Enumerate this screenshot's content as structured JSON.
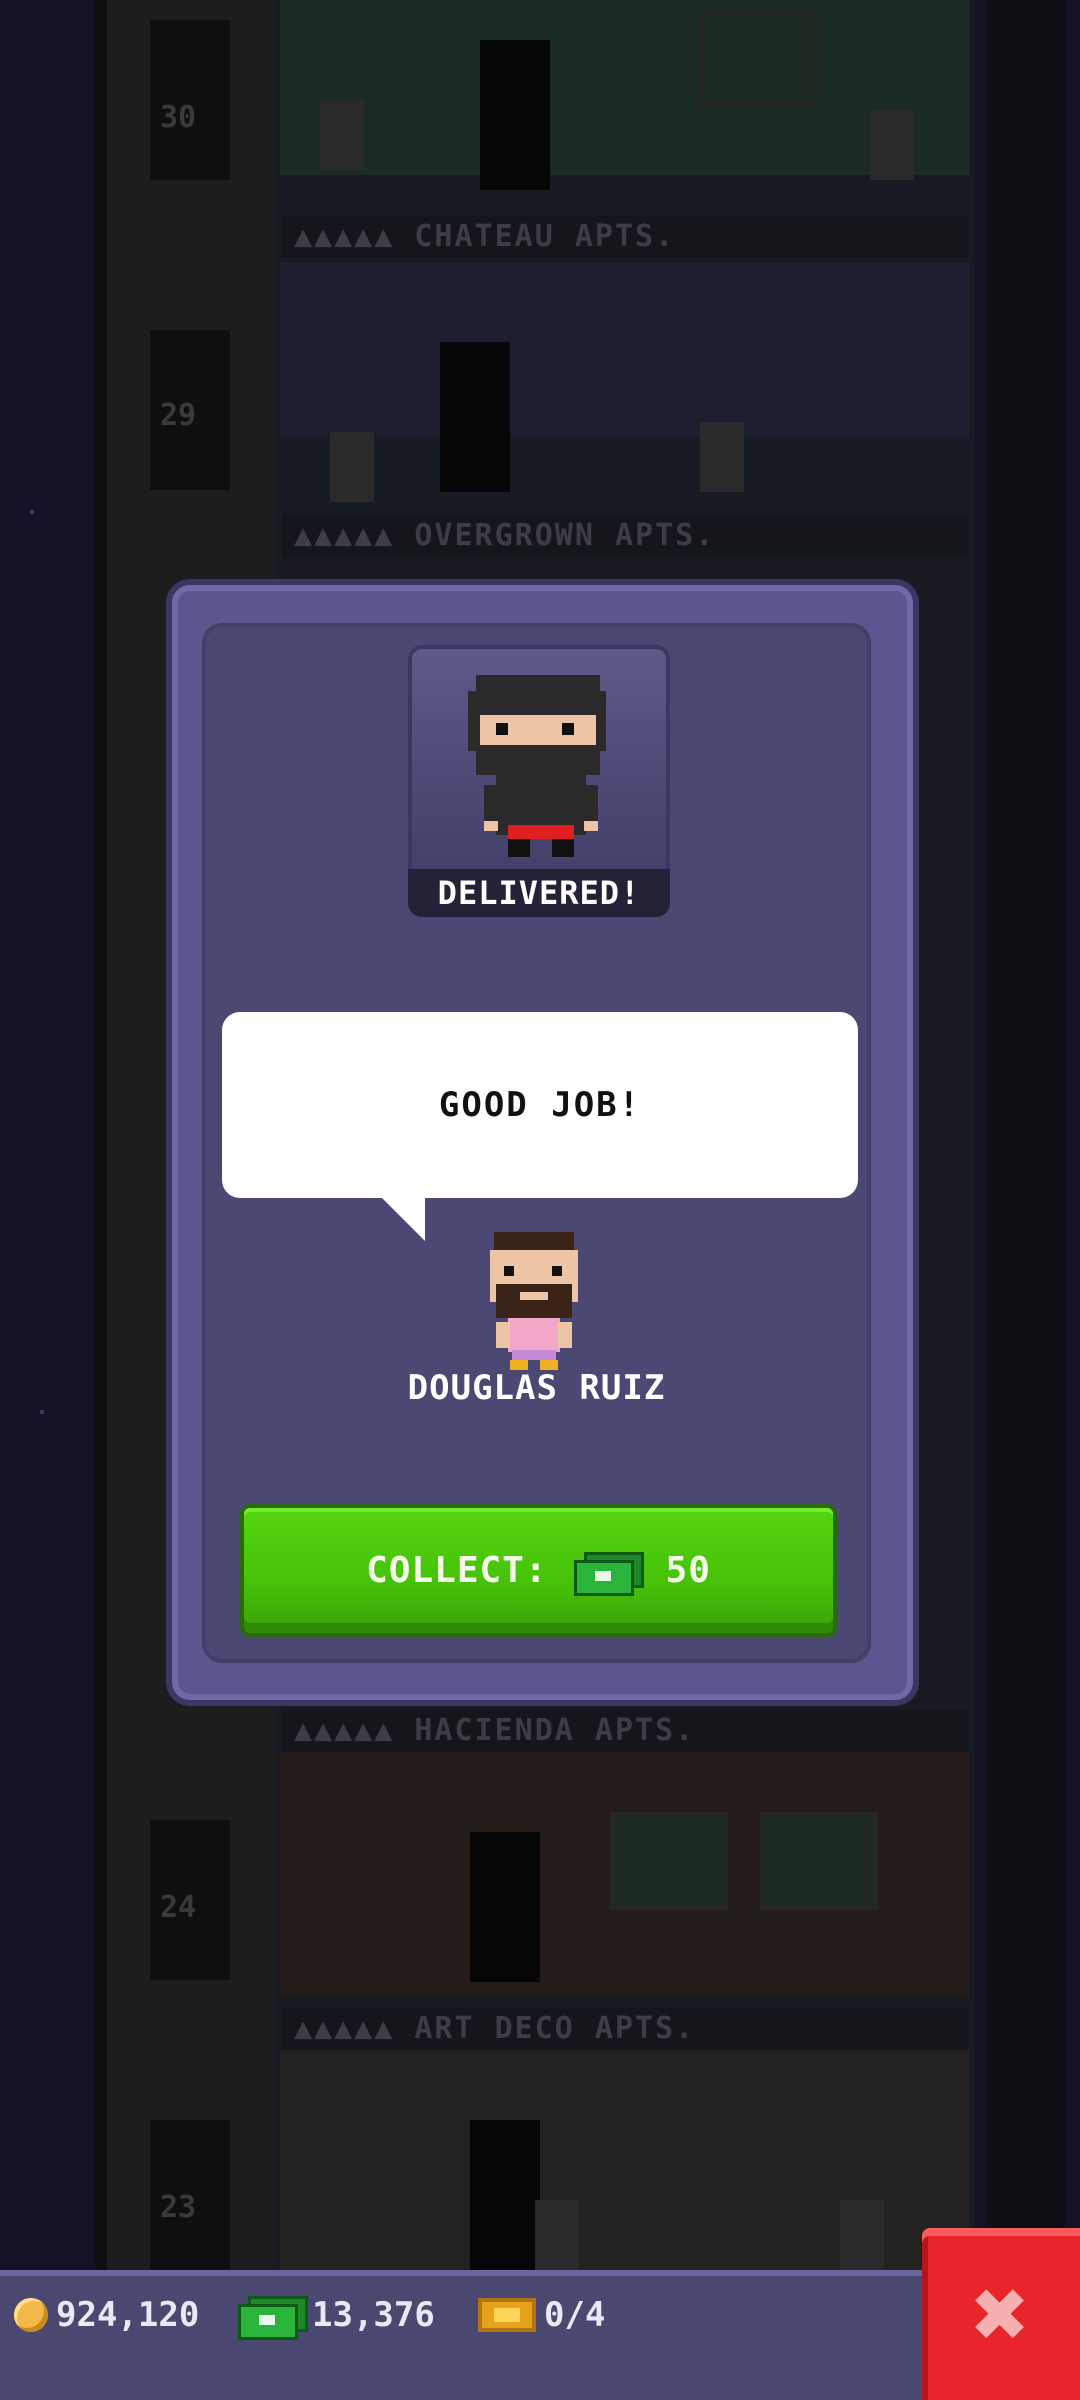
{
  "tower": {
    "floors": [
      {
        "number": "30",
        "banner": "▲▲▲▲▲ CHATEAU APTS."
      },
      {
        "number": "29",
        "banner": "▲▲▲▲▲ OVERGROWN APTS."
      },
      {
        "number": "24",
        "banner": "▲▲▲▲▲ HACIENDA APTS."
      },
      {
        "number": "23",
        "banner": "▲▲▲▲▲ ART DECO APTS."
      }
    ]
  },
  "dialog": {
    "status_label": "DELIVERED!",
    "speech": "GOOD JOB!",
    "npc_name": "DOUGLAS RUIZ",
    "collect_label": "COLLECT:",
    "collect_amount": "50"
  },
  "bottom_bar": {
    "coins": "924,120",
    "bux": "13,376",
    "tickets": "0/4"
  },
  "colors": {
    "collect_button": "#46c10a",
    "close_button": "#e8252b",
    "panel": "#4b4873"
  },
  "icons": [
    "coin-icon",
    "bux-icon",
    "ticket-icon",
    "close-icon",
    "cash-icon"
  ]
}
